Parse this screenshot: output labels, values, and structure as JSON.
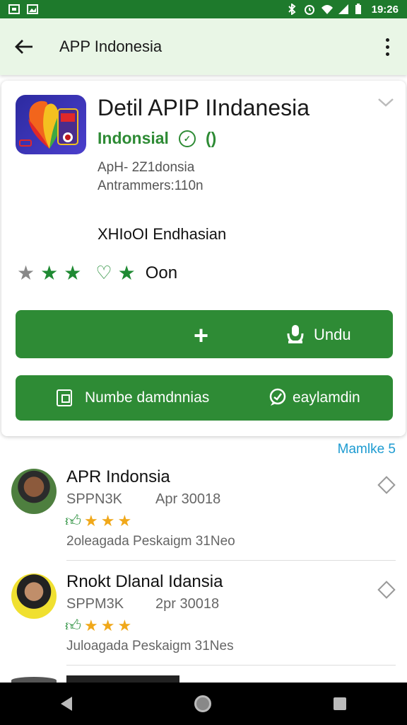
{
  "status_bar": {
    "time": "19:26"
  },
  "app_bar": {
    "title": "APP Indonesia"
  },
  "detail": {
    "title": "Detil APIP IIndanesia",
    "developer": "Indonsial",
    "developer_mark": "()",
    "meta_line1": "ApH- 2Z1donsia",
    "meta_line2": "Antrammers:110n",
    "category": "XHIoOI Endhasian",
    "rating_count": "Oon",
    "install_label": "Undu",
    "wishlist_label": "Numbe damdnnias",
    "share_label": "eaylamdin"
  },
  "more_link": "Mamlke 5",
  "reviews": [
    {
      "name": "APR Indonsia",
      "sub": "SPPN3K",
      "date": "Apr 30018",
      "desc": "2oleagada Peskaigm 31Neo"
    },
    {
      "name": "Rnokt Dlanal Idansia",
      "sub": "SPPM3K",
      "date": "2pr 30018",
      "desc": "Juloagada Peskaigm 31Nes"
    }
  ]
}
